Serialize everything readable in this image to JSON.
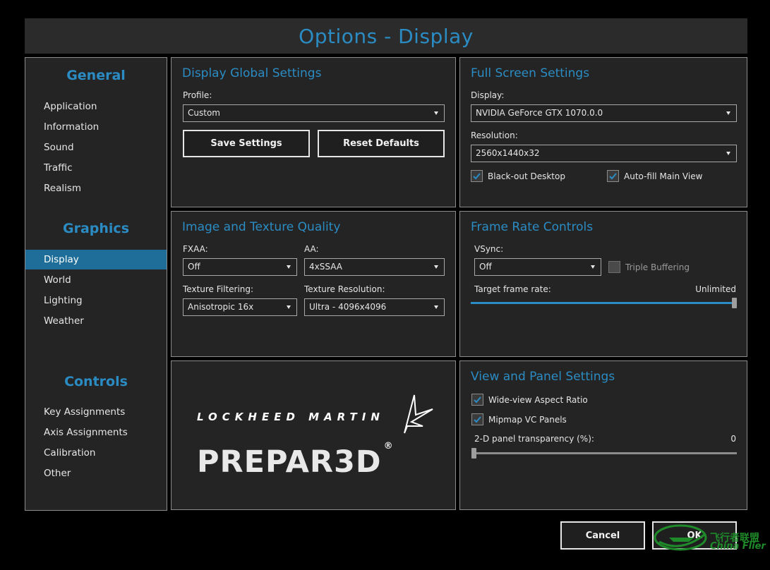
{
  "window": {
    "title": "Options - Display"
  },
  "sidebar": {
    "general": {
      "heading": "General",
      "items": [
        "Application",
        "Information",
        "Sound",
        "Traffic",
        "Realism"
      ]
    },
    "graphics": {
      "heading": "Graphics",
      "items": [
        "Display",
        "World",
        "Lighting",
        "Weather"
      ],
      "active": "Display"
    },
    "controls": {
      "heading": "Controls",
      "items": [
        "Key Assignments",
        "Axis Assignments",
        "Calibration",
        "Other"
      ]
    }
  },
  "display_global": {
    "title": "Display Global Settings",
    "profile_label": "Profile:",
    "profile_value": "Custom",
    "save_label": "Save Settings",
    "reset_label": "Reset Defaults"
  },
  "full_screen": {
    "title": "Full Screen Settings",
    "display_label": "Display:",
    "display_value": "NVIDIA GeForce GTX 1070.0.0",
    "resolution_label": "Resolution:",
    "resolution_value": "2560x1440x32",
    "blackout_label": "Black-out Desktop",
    "blackout_checked": true,
    "autofill_label": "Auto-fill Main View",
    "autofill_checked": true
  },
  "image_texture": {
    "title": "Image and Texture Quality",
    "fxaa_label": "FXAA:",
    "fxaa_value": "Off",
    "aa_label": "AA:",
    "aa_value": "4xSSAA",
    "filtering_label": "Texture Filtering:",
    "filtering_value": "Anisotropic 16x",
    "resolution_label": "Texture Resolution:",
    "resolution_value": "Ultra - 4096x4096"
  },
  "frame_rate": {
    "title": "Frame Rate Controls",
    "vsync_label": "VSync:",
    "vsync_value": "Off",
    "triple_label": "Triple Buffering",
    "triple_checked": false,
    "target_label": "Target frame rate:",
    "target_value": "Unlimited",
    "target_fraction": 1.0
  },
  "logo": {
    "brand": "LOCKHEED MARTIN",
    "product": "PREPAR3D",
    "reg": "®"
  },
  "view_panel": {
    "title": "View and Panel Settings",
    "wideview_label": "Wide-view Aspect Ratio",
    "wideview_checked": true,
    "mipmap_label": "Mipmap VC Panels",
    "mipmap_checked": true,
    "transparency_label": "2-D panel transparency (%):",
    "transparency_value": "0",
    "transparency_fraction": 0.0
  },
  "footer": {
    "cancel_label": "Cancel",
    "ok_label": "OK"
  },
  "watermark": {
    "line1": "飞行者联盟",
    "line2": "China Flier"
  },
  "colors": {
    "accent": "#2b8cc4",
    "panel_bg": "#242424",
    "active_nav": "#1e6e99",
    "watermark": "#1f8a2a"
  }
}
